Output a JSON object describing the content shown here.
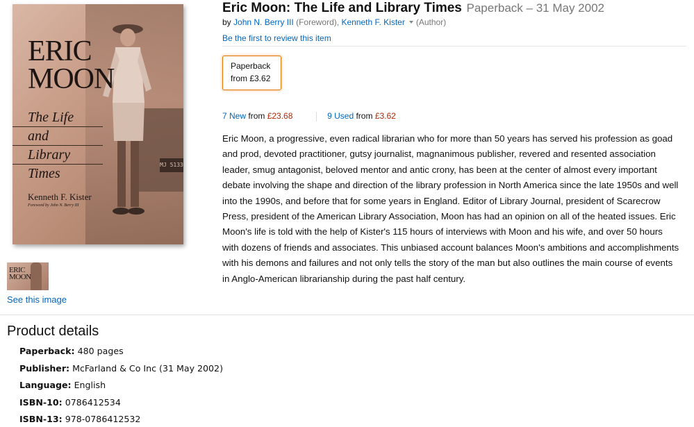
{
  "cover": {
    "title_line1": "ERIC",
    "title_line2": "MOON",
    "subtitle_line1": "The Life",
    "subtitle_line2": "and",
    "subtitle_line3": "Library",
    "subtitle_line4": "Times",
    "author": "Kenneth F. Kister",
    "foreword": "Foreword by John N. Berry III",
    "plate": "MJ 5133",
    "thumb_text_line1": "ERIC",
    "thumb_text_line2": "MOON",
    "see_image_link": "See this image"
  },
  "product": {
    "title": "Eric Moon: The Life and Library Times",
    "format_date": "Paperback – 31 May 2002",
    "by": "by",
    "contributors": [
      {
        "name": "John N. Berry III",
        "role": "(Foreword),"
      },
      {
        "name": "Kenneth F. Kister",
        "role": "(Author)"
      }
    ],
    "review_link": "Be the first to review this item"
  },
  "swatch": {
    "label": "Paperback",
    "price": "from £3.62"
  },
  "offers": {
    "new_link": "7 New",
    "new_from": "from",
    "new_price": "£23.68",
    "used_link": "9 Used",
    "used_from": "from",
    "used_price": "£3.62"
  },
  "description": "Eric Moon, a progressive, even radical librarian who for more than 50 years has served his profession as goad and prod, devoted practitioner, gutsy journalist, magnanimous publisher, revered and resented association leader, smug antagonist, beloved mentor and antic crony, has been at the center of almost every important debate involving the shape and direction of the library profession in North America since the late 1950s and well into the 1990s, and before that for some years in England. Editor of Library Journal, president of Scarecrow Press, president of the American Library Association, Moon has had an opinion on all of the heated issues. Eric Moon's life is told with the help of Kister's 115 hours of interviews with Moon and his wife, and over 50 hours with dozens of friends and associates. This unbiased account balances Moon's ambitions and accomplishments with his demons and failures and not only tells the story of the man but also outlines the main course of events in Anglo-American librarianship during the past half century.",
  "details": {
    "heading": "Product details",
    "items": [
      {
        "key": "Paperback:",
        "value": "480 pages"
      },
      {
        "key": "Publisher:",
        "value": "McFarland & Co Inc (31 May 2002)"
      },
      {
        "key": "Language:",
        "value": "English"
      },
      {
        "key": "ISBN-10:",
        "value": "0786412534"
      },
      {
        "key": "ISBN-13:",
        "value": "978-0786412532"
      }
    ]
  },
  "colors": {
    "link": "#0066c0",
    "price": "#b12704",
    "swatch_border": "#e77600"
  }
}
